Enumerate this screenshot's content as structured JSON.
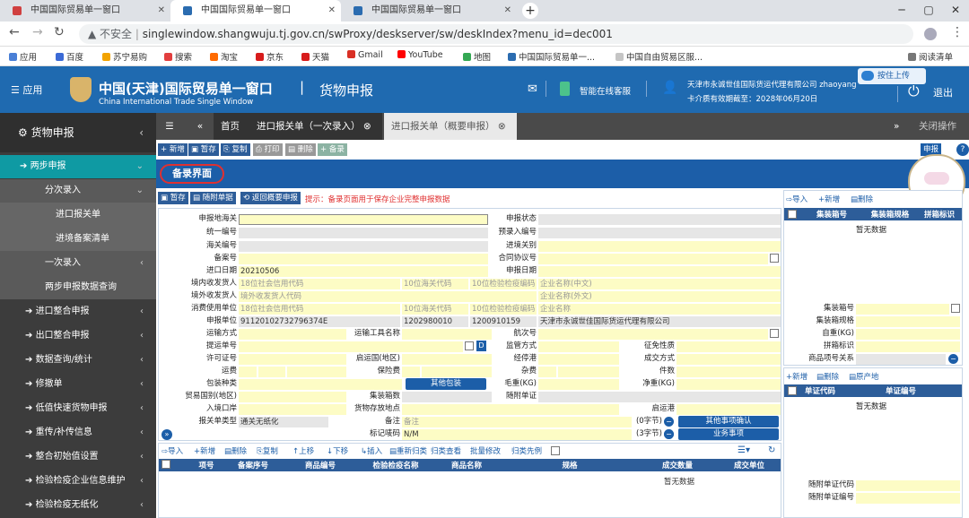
{
  "browser": {
    "tabs": [
      {
        "title": "中国国际贸易单一窗口"
      },
      {
        "title": "中国国际贸易单一窗口"
      },
      {
        "title": "中国国际贸易单一窗口"
      }
    ],
    "url_warning": "不安全",
    "url": "singlewindow.shangwuju.tj.gov.cn/swProxy/deskserver/sw/deskIndex?menu_id=dec001",
    "bookmarks": [
      "应用",
      "百度",
      "苏宁易购",
      "搜索",
      "淘宝",
      "京东",
      "天猫",
      "Gmail",
      "YouTube",
      "地图",
      "中国国际贸易单一...",
      "中国自由贸易区服..."
    ],
    "reading_list": "阅读清单"
  },
  "header": {
    "app_menu": "应用",
    "title_cn": "中国(天津)国际贸易单一窗口",
    "title_en": "China International Trade Single Window",
    "section": "货物申报",
    "service": "智能在线客服",
    "company": "天津市永诚世佳国际货运代理有限公司 zhaoyang",
    "card_expiry": "卡介质有效期截至：2028年06月20日",
    "logout": "退出",
    "upload": "按住上传"
  },
  "sidebar": {
    "title": "货物申报",
    "items": [
      {
        "label": "两步申报"
      },
      {
        "label": "分次录入"
      },
      {
        "label": "进口报关单"
      },
      {
        "label": "进境备案清单"
      },
      {
        "label": "一次录入"
      },
      {
        "label": "两步申报数据查询"
      },
      {
        "label": "进口整合申报"
      },
      {
        "label": "出口整合申报"
      },
      {
        "label": "数据查询/统计"
      },
      {
        "label": "修撤单"
      },
      {
        "label": "低值快速货物申报"
      },
      {
        "label": "重传/补传信息"
      },
      {
        "label": "整合初始值设置"
      },
      {
        "label": "检验检疫企业信息维护"
      },
      {
        "label": "检验检疫无纸化"
      }
    ]
  },
  "tabs": {
    "home": "首页",
    "tab1": "进口报关单（一次录入）",
    "tab2": "进口报关单（概要申报）",
    "close_ops": "关闭操作"
  },
  "toolbar": {
    "buttons": [
      "新增",
      "暂存",
      "复制",
      "打印",
      "删除",
      "备录"
    ],
    "declare": "申报"
  },
  "form": {
    "section_title": "备录界面",
    "actions": [
      "暂存",
      "随附单据",
      "返回概要申报"
    ],
    "hint": "提示：备录页面用于保存企业完整申报数据",
    "fields": {
      "customs": "申报地海关",
      "status": "申报状态",
      "unified_no": "统一编号",
      "pre_entry_no": "预录入编号",
      "customs_no": "海关编号",
      "entry_port": "进境关别",
      "record_no": "备案号",
      "contract_no": "合同协议号",
      "import_date": "进口日期",
      "import_date_val": "20210506",
      "declare_date": "申报日期",
      "consignee": "境内收发货人",
      "credit_code_ph": "18位社会信用代码",
      "customs_code_ph": "10位海关代码",
      "ciq_code_ph": "10位检验检疫编码",
      "company_cn_ph": "企业名称(中文)",
      "overseas": "境外收发货人",
      "overseas_code_ph": "境外收发货人代码",
      "company_en_ph": "企业名称(外文)",
      "consumer": "消费使用单位",
      "company_ph": "企业名称",
      "declarant": "申报单位",
      "declarant_credit": "91120102732796374E",
      "declarant_customs": "1202980010",
      "declarant_ciq": "1200910159",
      "declarant_name": "天津市永诚世佳国际货运代理有限公司",
      "transport_mode": "运输方式",
      "transport_name": "运输工具名称",
      "voyage": "航次号",
      "bill_no": "提运单号",
      "supervision": "监管方式",
      "exemption": "征免性质",
      "license": "许可证号",
      "origin_country": "启运国(地区)",
      "via_port": "经停港",
      "deal_mode": "成交方式",
      "freight": "运费",
      "insurance": "保险费",
      "misc": "杂费",
      "packages": "件数",
      "pack_type": "包装种类",
      "other_pack": "其他包装",
      "gross": "毛重(KG)",
      "net": "净重(KG)",
      "trade_country": "贸易国别(地区)",
      "container_count": "集装箱数",
      "docs": "随附单证",
      "entry_port2": "入境口岸",
      "storage": "货物存放地点",
      "departure_port": "启运港",
      "decl_type": "报关单类型",
      "decl_type_val": "通关无纸化",
      "remark": "备注",
      "remark_ph": "备注",
      "remark_count": "(0字节)",
      "other_confirm": "其他事项确认",
      "mark": "标记唛码",
      "mark_val": "N/M",
      "mark_count": "(3字节)",
      "business": "业务事项"
    }
  },
  "goods": {
    "buttons": [
      "导入",
      "新增",
      "删除",
      "复制",
      "上移",
      "下移",
      "插入",
      "重新归类",
      "归类查看",
      "批量修改",
      "归类先例"
    ],
    "columns": [
      "项号",
      "备案序号",
      "商品编号",
      "检验检疫名称",
      "商品名称",
      "规格",
      "成交数量",
      "成交单位"
    ],
    "empty": "暂无数据"
  },
  "container": {
    "buttons": [
      "导入",
      "新增",
      "删除"
    ],
    "columns": [
      "集装箱号",
      "集装箱规格",
      "拼箱标识"
    ],
    "empty": "暂无数据",
    "fields": [
      "集装箱号",
      "集装箱规格",
      "自重(KG)",
      "拼箱标识",
      "商品项号关系"
    ]
  },
  "docs_panel": {
    "buttons": [
      "新增",
      "删除",
      "原产地"
    ],
    "columns": [
      "单证代码",
      "单证编号"
    ],
    "empty": "暂无数据",
    "fields": [
      "随附单证代码",
      "随附单证编号"
    ]
  }
}
